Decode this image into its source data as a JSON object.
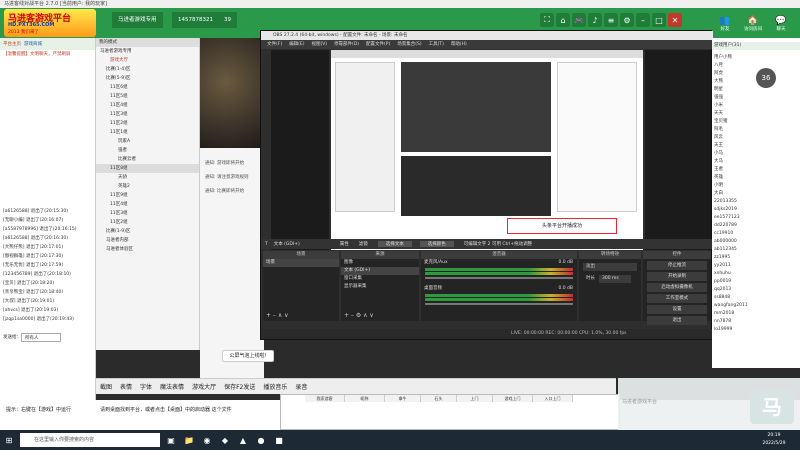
{
  "window": {
    "title": "马进客线对战平台 2.7.0 [当前用户: 我的玩家]"
  },
  "header": {
    "logo_line1": "马进客游戏平台",
    "logo_line2": "HD.PXT365.COM",
    "logo_line3": "2013 我们来了",
    "tab_room": "马进者游戏专用",
    "phone": "1457878321",
    "count": "39",
    "right_buttons": [
      {
        "icon": "friends-icon",
        "label": "好友"
      },
      {
        "icon": "room-icon",
        "label": "访问房间"
      },
      {
        "icon": "chat-icon",
        "label": "聊天"
      }
    ]
  },
  "left_panel": {
    "top_links": [
      "平台主页",
      "游戏商城"
    ],
    "announcement": "【温馨提醒】文明聊天，严禁刷屏",
    "messages": [
      "[a6126588] 退出了(20:15:30)",
      "[无聊小编] 退出了(20:16:07)",
      "[a5587978996] 退出了(20:16:15)",
      "[a6126588] 退出了(20:16:30)",
      "[大熊仔熊] 退出了(20:17:01)",
      "[傲视群雄] 退出了(20:17:30)",
      "[无乐无忧] 退出了(20:17:59)",
      "[123456789] 退出了(20:18:10)",
      "[宝贝] 退出了(20:18:20)",
      "[亲亲熊宝] 退出了(20:18:40)",
      "[大叔] 退出了(20:19:01)",
      "[ahvcs] 退出了(20:19:03)",
      "[jzqp1sa0000] 退出了(20:19:43)"
    ],
    "chat_target_label": "发送给：",
    "chat_target_value": "所有人"
  },
  "tree_panel": {
    "header": "我的模式",
    "items": [
      "马进者游戏专用",
      "游戏大厅",
      "比赛(1-4)区",
      "比赛(5-9)区",
      "11区6组",
      "11区5组",
      "11区4组",
      "11区3组",
      "11区2组",
      "11区1组",
      "玩家A",
      "强者",
      "比赛云者",
      "11区8组",
      "天骄",
      "英雄2",
      "11区9组",
      "11区4组",
      "11区3组",
      "11区2组",
      "比赛(1-9)区",
      "马进者内部",
      "马进者体验区"
    ]
  },
  "chat_area": {
    "notices": [
      "通知: 游戏即将开始",
      "通知: 请注意游戏规则",
      "通知: 比赛即将开始"
    ],
    "bubble": "公屏气泡上线啦!"
  },
  "obs": {
    "title": "OBS 27.2.4 (64-bit, windows) - 配置文件: 未命名 - 场景: 未命名",
    "menu": [
      "文件(F)",
      "编辑(E)",
      "视图(V)",
      "停靠部件(D)",
      "配置文件(P)",
      "场景集合(S)",
      "工具(T)",
      "帮助(H)"
    ],
    "source_bar": {
      "current": "文本 (GDI+)",
      "props": "属性",
      "filters": "滤镜",
      "text_label": "选择文本",
      "color_label": "选择颜色",
      "hint": "可编辑文字 2 可用 Ctrl+拖动调整"
    },
    "preview_caption": "头条平台开播成功",
    "docks": {
      "scenes_title": "场景",
      "scenes": [
        "场景"
      ],
      "sources_title": "来源",
      "sources": [
        "图像",
        "文本 (GDI+)",
        "窗口采集",
        "显示器采集"
      ],
      "mixer_title": "混音器",
      "mixer_channels": [
        {
          "name": "麦克风/Aux",
          "db": "0.0 dB"
        },
        {
          "name": "桌面音频",
          "db": "0.0 dB"
        }
      ],
      "transitions_title": "转场特效",
      "transition_type": "淡出",
      "duration_label": "时长",
      "duration_value": "300 ms",
      "controls_title": "控件",
      "controls": [
        "停止推流",
        "开始录制",
        "启动虚拟摄像机",
        "工作室模式",
        "设置",
        "退出"
      ]
    },
    "status": "LIVE: 00:00:00   REC: 00:00:00   CPU: 1.0%, 30.00 fps"
  },
  "right_list": {
    "badge": "36",
    "header": "游戏用户(31)",
    "users": [
      "用户小熊",
      "八月",
      "阿虎",
      "大熊",
      "明星",
      "强强",
      "小米",
      "天天",
      "宝贝猪",
      "阿毛",
      "风云",
      "天王",
      "小马",
      "大马",
      "王者",
      "英雄",
      "小明",
      "大白",
      "22013355",
      "sdjks2019",
      "ee1577123",
      "dd220789",
      "cc19910",
      "ab000000",
      "ab112345",
      "zz1995",
      "yy2011",
      "xxhuhu",
      "pp0019",
      "qq2013",
      "ss8848",
      "wangfang2011",
      "mm2018",
      "nn7878",
      "lo19999"
    ]
  },
  "chat_toolbar": {
    "items": [
      "截图",
      "表情",
      "字体",
      "魔法表情",
      "游戏大厅",
      "保存F2发送",
      "播放音乐",
      "录音"
    ]
  },
  "bottom_bar": {
    "prompt": "提示：右键在【游戏】中运行",
    "tip": "请到桌面找到平台，或者点击【桌面】中的启动器 这个文件"
  },
  "sheet": {
    "headers": [
      "我家游客",
      "昵称",
      "拿牛",
      "石头",
      "上门",
      "游戏上门",
      "入口上门"
    ]
  },
  "watermark": {
    "text": "马进者游戏平台"
  },
  "taskbar": {
    "search_placeholder": "在这里输入你要搜索的内容",
    "time": "20:19",
    "date": "2022/5/29"
  }
}
